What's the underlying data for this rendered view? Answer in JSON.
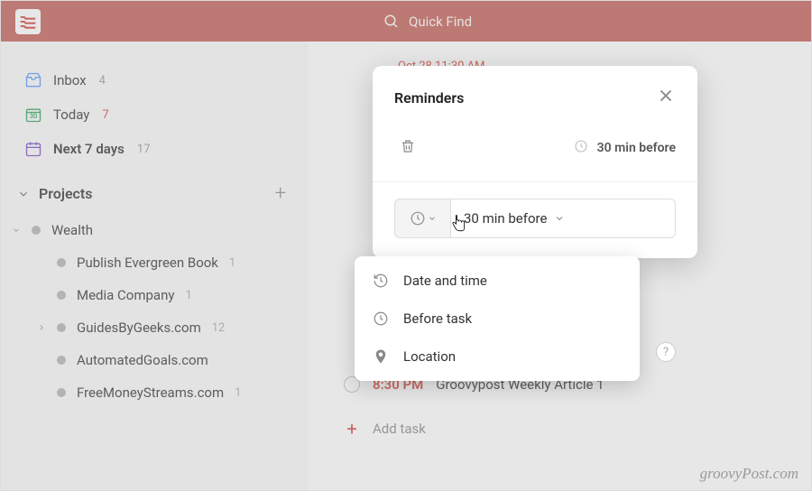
{
  "header": {
    "search_placeholder": "Quick Find"
  },
  "sidebar": {
    "inbox": {
      "label": "Inbox",
      "count": "4"
    },
    "today": {
      "label": "Today",
      "count": "7"
    },
    "next7": {
      "label": "Next 7 days",
      "count": "17"
    },
    "projects_label": "Projects",
    "wealth": {
      "label": "Wealth"
    },
    "items": [
      {
        "label": "Publish Evergreen Book",
        "count": "1"
      },
      {
        "label": "Media Company",
        "count": "1"
      },
      {
        "label": "GuidesByGeeks.com",
        "count": "12"
      },
      {
        "label": "AutomatedGoals.com"
      },
      {
        "label": "FreeMoneyStreams.com",
        "count": "1"
      }
    ]
  },
  "main": {
    "peek_date": "Oct 28 11:30 AM",
    "task": {
      "time": "8:30 PM",
      "title": "Groovypost Weekly Article 1"
    },
    "add_task": "Add task"
  },
  "popover": {
    "title": "Reminders",
    "existing_value": "30 min before",
    "input_value": "30 min before",
    "help": "?",
    "dropdown": [
      {
        "label": "Date and time"
      },
      {
        "label": "Before task"
      },
      {
        "label": "Location"
      }
    ]
  },
  "watermark": "groovyPost.com"
}
